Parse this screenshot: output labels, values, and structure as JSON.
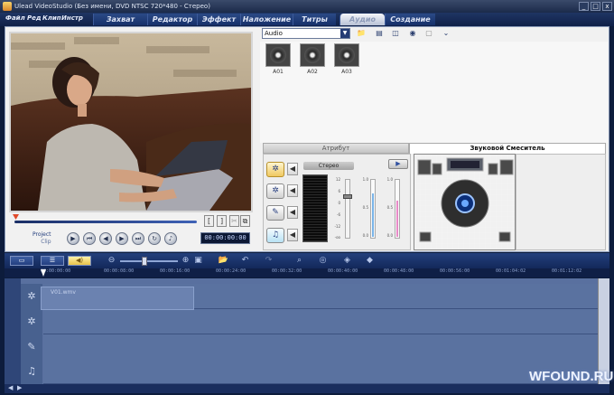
{
  "window": {
    "title": "Ulead VideoStudio (Без имени, DVD NTSC 720*480 - Стерео)",
    "min": "_",
    "max": "□",
    "close": "x"
  },
  "menu": {
    "items": [
      "Файл",
      "Ред",
      "Клип",
      "Инстр"
    ]
  },
  "steps": [
    {
      "label": "Захват"
    },
    {
      "label": "Редактор"
    },
    {
      "label": "Эффект"
    },
    {
      "label": "Наложение"
    },
    {
      "label": "Титры"
    },
    {
      "label": "Аудио"
    },
    {
      "label": "Создание"
    }
  ],
  "active_step": "Аудио",
  "preview": {
    "project_label": "Project",
    "clip_label": "Clip",
    "timecode": "00:00:00:00",
    "mark_in": "[",
    "mark_out": "]"
  },
  "library": {
    "selected": "Audio",
    "thumbs": [
      {
        "caption": "A01"
      },
      {
        "caption": "A02"
      },
      {
        "caption": "A03"
      }
    ]
  },
  "options_tabs": {
    "attribute": "Атрибут",
    "mixer": "Звуковой Смеситель"
  },
  "mixer": {
    "stereo_label": "Стерео",
    "scale": [
      "12",
      "6",
      "0",
      "-6",
      "-12",
      "-oo"
    ],
    "scale2": [
      "1.0",
      "0.5",
      "0.0"
    ]
  },
  "timeline": {
    "ticks": [
      "00:00:00:00",
      "00:00:08:00",
      "00:00:16:00",
      "00:00:24:00",
      "00:00:32:00",
      "00:00:40:00",
      "00:00:48:00",
      "00:00:56:00",
      "00:01:04:02",
      "00:01:12:02"
    ],
    "clip_name": "V01.wmv"
  },
  "watermark": "WFOUND.RU"
}
